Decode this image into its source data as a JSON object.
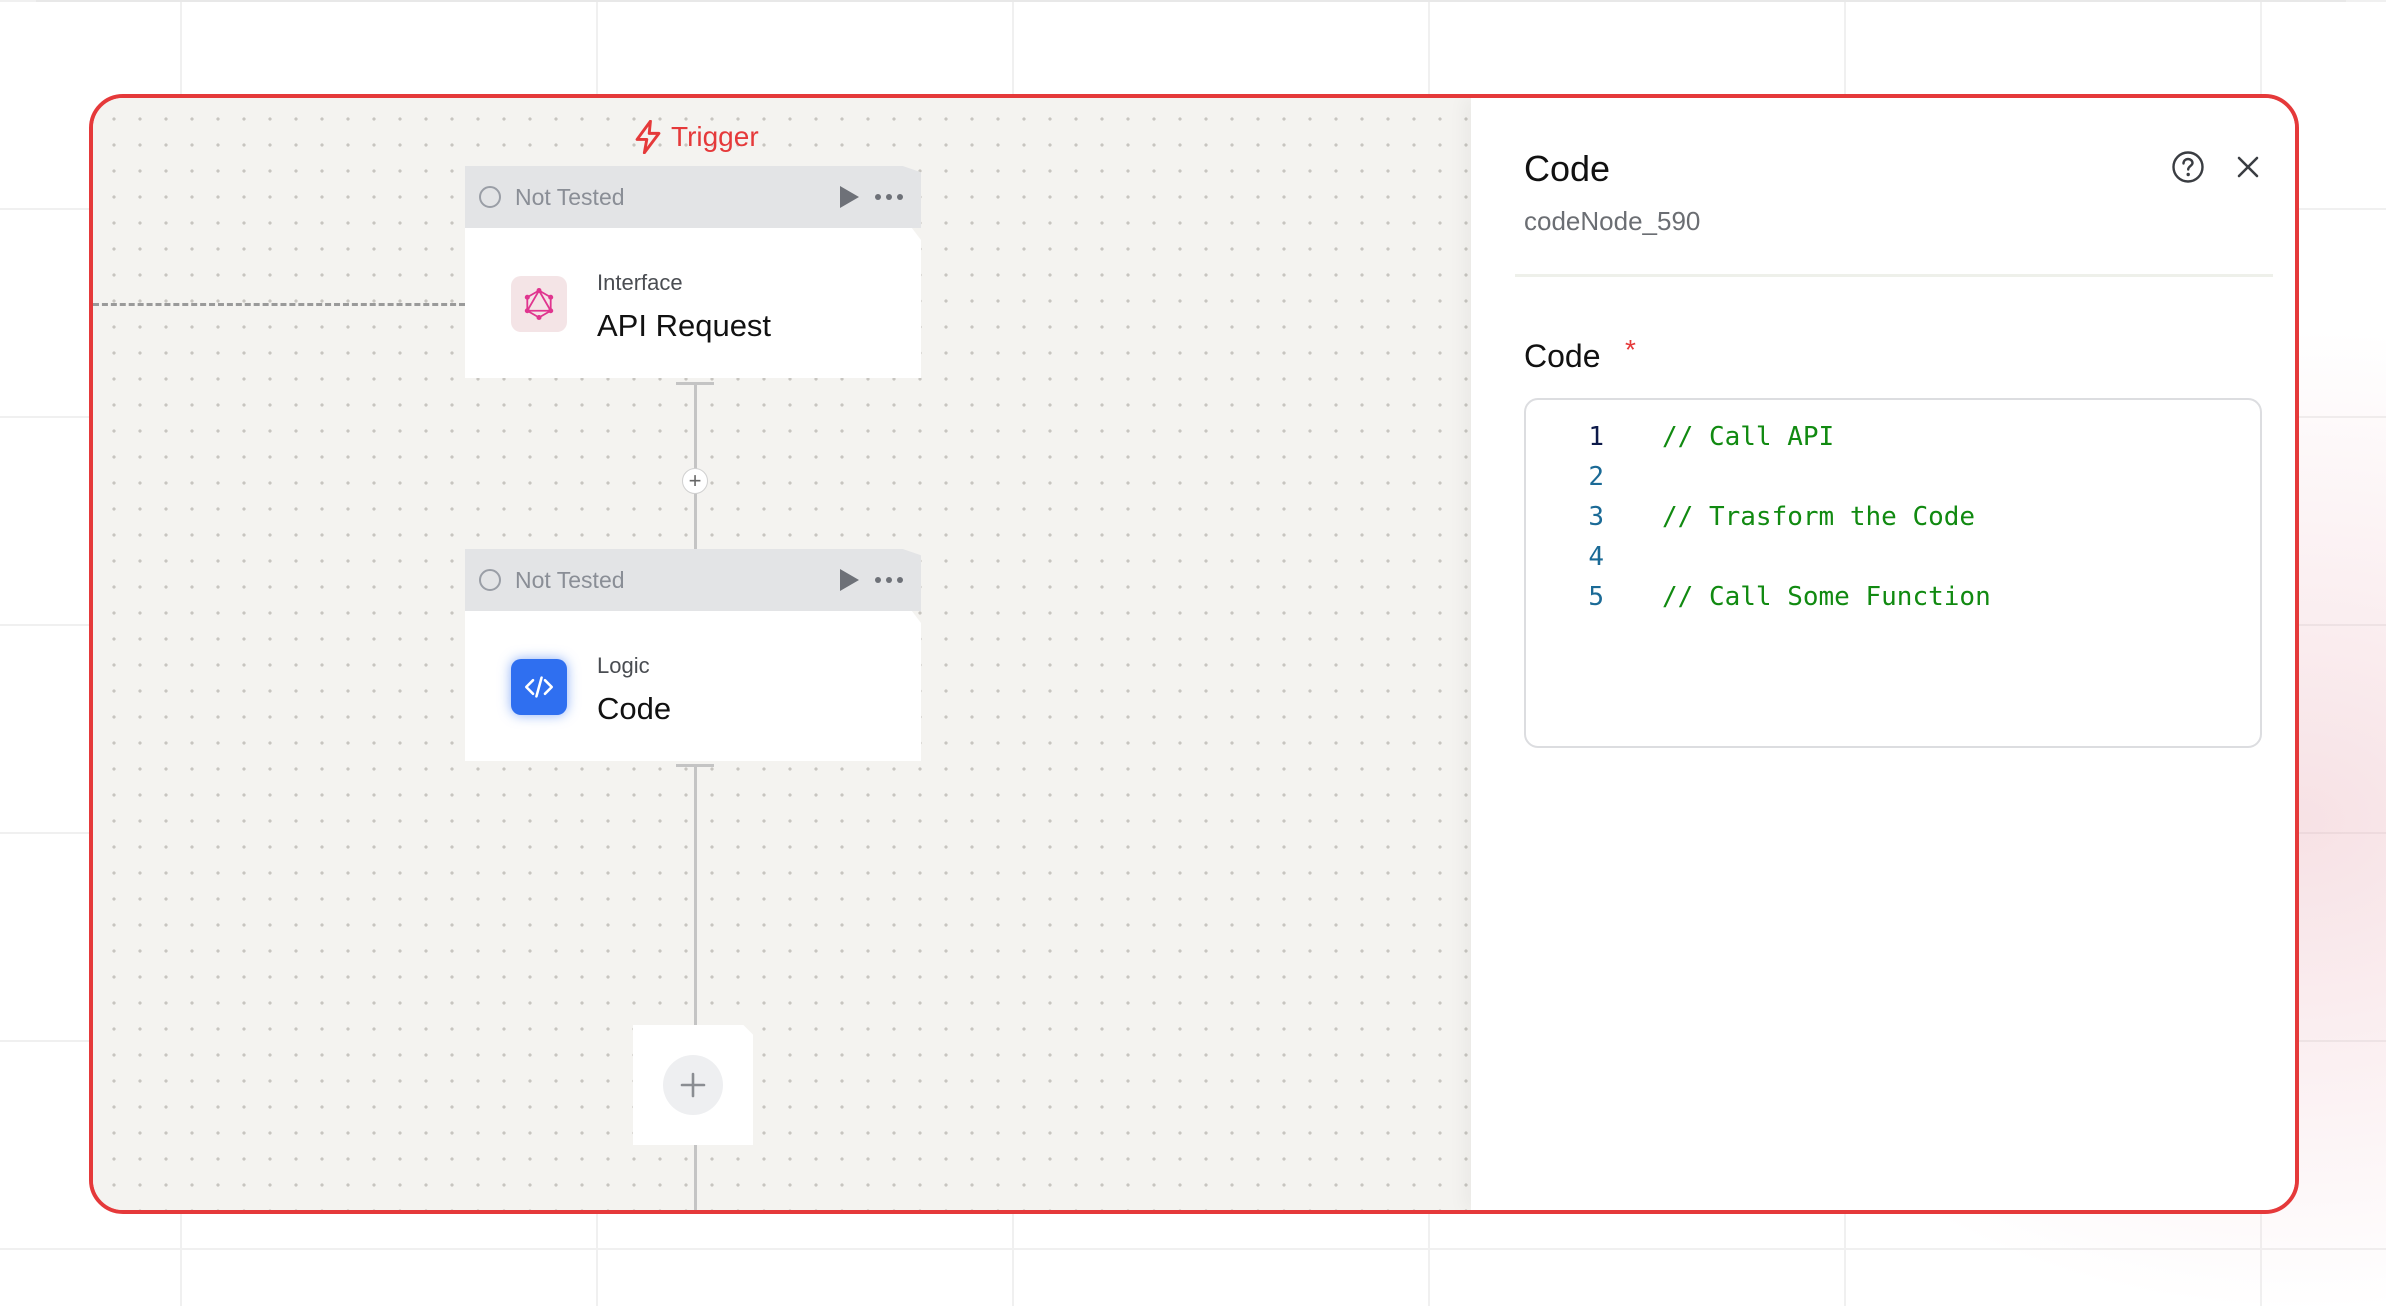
{
  "canvas": {
    "trigger_label": "Trigger",
    "nodes": [
      {
        "status": "Not Tested",
        "category": "Interface",
        "title": "API Request",
        "icon": "graphql-icon"
      },
      {
        "status": "Not Tested",
        "category": "Logic",
        "title": "Code",
        "icon": "code-icon"
      }
    ],
    "add_step_symbol": "+"
  },
  "panel": {
    "title": "Code",
    "subtitle": "codeNode_590",
    "field_label": "Code",
    "required_mark": "*",
    "code_lines": [
      {
        "number": "1",
        "text": "// Call API"
      },
      {
        "number": "2",
        "text": ""
      },
      {
        "number": "3",
        "text": "// Trasform the Code"
      },
      {
        "number": "4",
        "text": ""
      },
      {
        "number": "5",
        "text": "// Call Some Function"
      }
    ]
  },
  "colors": {
    "accent": "#e5393a",
    "code_comment": "#118a11",
    "code_icon_bg": "#2f6ff0"
  }
}
